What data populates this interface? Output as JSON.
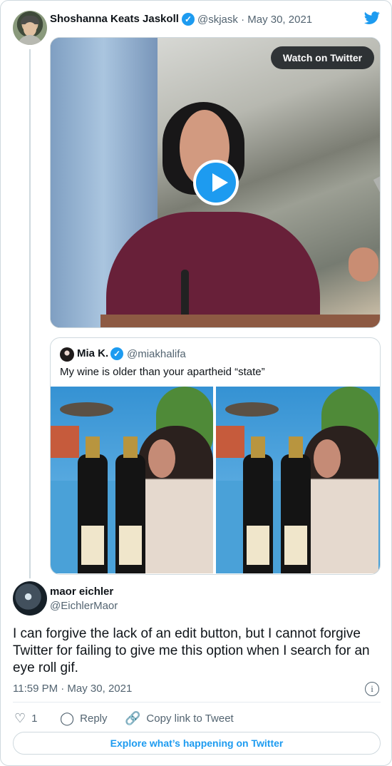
{
  "tweet": {
    "author_name": "Shoshanna Keats Jaskoll",
    "author_handle": "@skjask",
    "date": "May 30, 2021",
    "handle_date": "@skjask · May 30, 2021",
    "watch_label": "Watch on Twitter"
  },
  "quoted": {
    "author_name": "Mia K.",
    "author_handle": "@miakhalifa",
    "text": "My wine is older than your apartheid “state”"
  },
  "reply": {
    "author_name": "maor eichler",
    "author_handle": "@EichlerMaor",
    "text": "I can forgive the lack of an edit button, but I cannot forgive Twitter for failing to give me this option when I search for an eye roll gif.",
    "time": "11:59 PM · May 30, 2021"
  },
  "actions": {
    "likes": "1",
    "reply_label": "Reply",
    "copy_label": "Copy link to Tweet"
  },
  "explore_label": "Explore what’s happening on Twitter",
  "icons": [
    "heart-icon",
    "reply-icon",
    "link-icon",
    "twitter-bird-icon",
    "verified-icon",
    "play-icon",
    "info-icon"
  ],
  "colors": {
    "accent": "#1d9bf0",
    "muted": "#536471",
    "border": "#cfd9de"
  }
}
